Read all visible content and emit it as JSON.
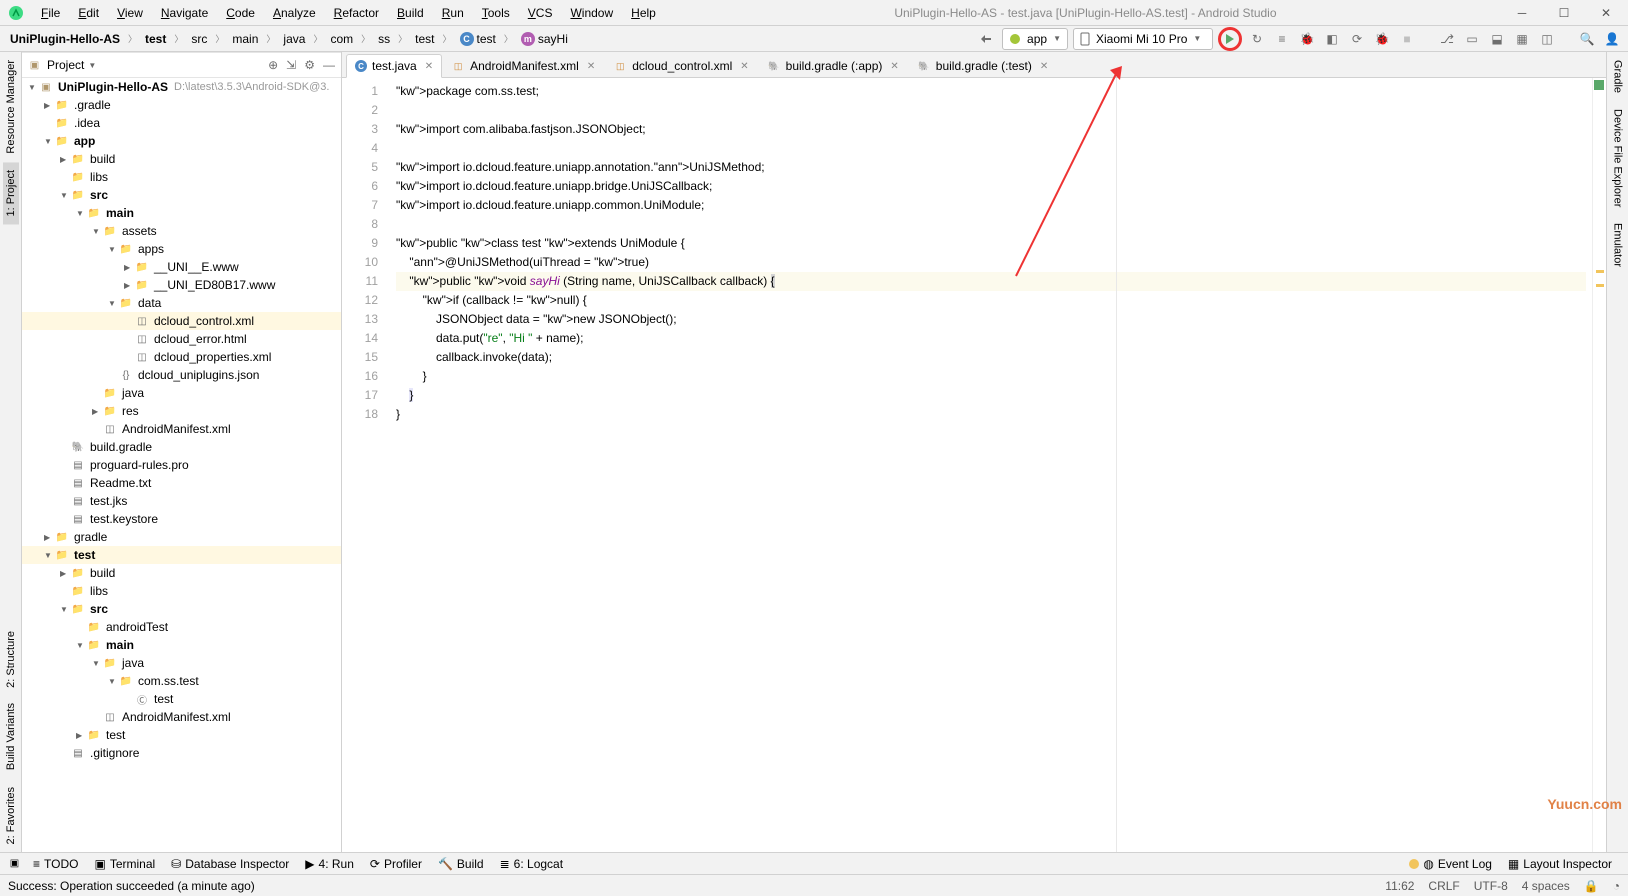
{
  "window": {
    "title": "UniPlugin-Hello-AS - test.java [UniPlugin-Hello-AS.test] - Android Studio"
  },
  "menu": [
    "File",
    "Edit",
    "View",
    "Navigate",
    "Code",
    "Analyze",
    "Refactor",
    "Build",
    "Run",
    "Tools",
    "VCS",
    "Window",
    "Help"
  ],
  "breadcrumbs": [
    {
      "label": "UniPlugin-Hello-AS",
      "bold": true
    },
    {
      "label": "test",
      "bold": true
    },
    {
      "label": "src"
    },
    {
      "label": "main"
    },
    {
      "label": "java"
    },
    {
      "label": "com"
    },
    {
      "label": "ss"
    },
    {
      "label": "test"
    },
    {
      "label": "test",
      "icon": "class"
    },
    {
      "label": "sayHi",
      "icon": "method"
    }
  ],
  "run_config": {
    "module": "app",
    "device": "Xiaomi Mi 10 Pro"
  },
  "project_pane": {
    "title": "Project",
    "root": {
      "label": "UniPlugin-Hello-AS",
      "path": "D:\\latest\\3.5.3\\Android-SDK@3."
    }
  },
  "tree": [
    {
      "depth": 0,
      "arrow": "▼",
      "icon": "proj",
      "label": "UniPlugin-Hello-AS",
      "extra": "D:\\latest\\3.5.3\\Android-SDK@3.",
      "bold": true
    },
    {
      "depth": 1,
      "arrow": "▶",
      "icon": "folder",
      "label": ".gradle"
    },
    {
      "depth": 1,
      "arrow": "",
      "icon": "folder",
      "label": ".idea"
    },
    {
      "depth": 1,
      "arrow": "▼",
      "icon": "folder",
      "label": "app",
      "bold": true
    },
    {
      "depth": 2,
      "arrow": "▶",
      "icon": "build",
      "label": "build"
    },
    {
      "depth": 2,
      "arrow": "",
      "icon": "folder",
      "label": "libs"
    },
    {
      "depth": 2,
      "arrow": "▼",
      "icon": "src",
      "label": "src",
      "bold": true
    },
    {
      "depth": 3,
      "arrow": "▼",
      "icon": "folder",
      "label": "main",
      "bold": true
    },
    {
      "depth": 4,
      "arrow": "▼",
      "icon": "folder",
      "label": "assets"
    },
    {
      "depth": 5,
      "arrow": "▼",
      "icon": "folder",
      "label": "apps"
    },
    {
      "depth": 6,
      "arrow": "▶",
      "icon": "folder",
      "label": "__UNI__E.www"
    },
    {
      "depth": 6,
      "arrow": "▶",
      "icon": "folder",
      "label": "__UNI_ED80B17.www"
    },
    {
      "depth": 5,
      "arrow": "▼",
      "icon": "folder",
      "label": "data"
    },
    {
      "depth": 6,
      "arrow": "",
      "icon": "xml",
      "label": "dcloud_control.xml",
      "sel": true
    },
    {
      "depth": 6,
      "arrow": "",
      "icon": "html",
      "label": "dcloud_error.html"
    },
    {
      "depth": 6,
      "arrow": "",
      "icon": "xml",
      "label": "dcloud_properties.xml"
    },
    {
      "depth": 5,
      "arrow": "",
      "icon": "json",
      "label": "dcloud_uniplugins.json"
    },
    {
      "depth": 4,
      "arrow": "",
      "icon": "src",
      "label": "java"
    },
    {
      "depth": 4,
      "arrow": "▶",
      "icon": "res",
      "label": "res"
    },
    {
      "depth": 4,
      "arrow": "",
      "icon": "xml",
      "label": "AndroidManifest.xml"
    },
    {
      "depth": 2,
      "arrow": "",
      "icon": "gradle",
      "label": "build.gradle"
    },
    {
      "depth": 2,
      "arrow": "",
      "icon": "file",
      "label": "proguard-rules.pro"
    },
    {
      "depth": 2,
      "arrow": "",
      "icon": "file",
      "label": "Readme.txt"
    },
    {
      "depth": 2,
      "arrow": "",
      "icon": "file",
      "label": "test.jks"
    },
    {
      "depth": 2,
      "arrow": "",
      "icon": "file",
      "label": "test.keystore"
    },
    {
      "depth": 1,
      "arrow": "▶",
      "icon": "folder",
      "label": "gradle"
    },
    {
      "depth": 1,
      "arrow": "▼",
      "icon": "folder",
      "label": "test",
      "bold": true,
      "sel2": true
    },
    {
      "depth": 2,
      "arrow": "▶",
      "icon": "build",
      "label": "build"
    },
    {
      "depth": 2,
      "arrow": "",
      "icon": "folder",
      "label": "libs"
    },
    {
      "depth": 2,
      "arrow": "▼",
      "icon": "src",
      "label": "src",
      "bold": true
    },
    {
      "depth": 3,
      "arrow": "",
      "icon": "folder",
      "label": "androidTest"
    },
    {
      "depth": 3,
      "arrow": "▼",
      "icon": "folder",
      "label": "main",
      "bold": true
    },
    {
      "depth": 4,
      "arrow": "▼",
      "icon": "src",
      "label": "java"
    },
    {
      "depth": 5,
      "arrow": "▼",
      "icon": "folder",
      "label": "com.ss.test"
    },
    {
      "depth": 6,
      "arrow": "",
      "icon": "class",
      "label": "test"
    },
    {
      "depth": 4,
      "arrow": "",
      "icon": "xml",
      "label": "AndroidManifest.xml"
    },
    {
      "depth": 3,
      "arrow": "▶",
      "icon": "folder",
      "label": "test"
    },
    {
      "depth": 2,
      "arrow": "",
      "icon": "file",
      "label": ".gitignore"
    }
  ],
  "tabs": [
    {
      "label": "test.java",
      "icon": "class",
      "active": true
    },
    {
      "label": "AndroidManifest.xml",
      "icon": "xml"
    },
    {
      "label": "dcloud_control.xml",
      "icon": "xml"
    },
    {
      "label": "build.gradle (:app)",
      "icon": "gradle"
    },
    {
      "label": "build.gradle (:test)",
      "icon": "gradle"
    }
  ],
  "code": {
    "lines": 18,
    "text": [
      "package com.ss.test;",
      "",
      "import com.alibaba.fastjson.JSONObject;",
      "",
      "import io.dcloud.feature.uniapp.annotation.UniJSMethod;",
      "import io.dcloud.feature.uniapp.bridge.UniJSCallback;",
      "import io.dcloud.feature.uniapp.common.UniModule;",
      "",
      "public class test extends UniModule {",
      "    @UniJSMethod(uiThread = true)",
      "    public void sayHi (String name, UniJSCallback callback) {",
      "        if (callback != null) {",
      "            JSONObject data = new JSONObject();",
      "            data.put(\"re\", \"Hi \" + name);",
      "            callback.invoke(data);",
      "        }",
      "    }",
      "}"
    ]
  },
  "left_tool_windows": [
    {
      "label": "Resource Manager"
    },
    {
      "label": "1: Project",
      "selected": true
    }
  ],
  "left_tool_windows_bottom": [
    {
      "label": "2: Structure"
    },
    {
      "label": "Build Variants"
    },
    {
      "label": "2: Favorites"
    }
  ],
  "right_tool_windows": [
    {
      "label": "Gradle"
    },
    {
      "label": "Device File Explorer"
    },
    {
      "label": "Emulator"
    }
  ],
  "bottom_tools_left": [
    {
      "icon": "≡",
      "label": "TODO"
    },
    {
      "icon": "▣",
      "label": "Terminal"
    },
    {
      "icon": "⛁",
      "label": "Database Inspector"
    },
    {
      "icon": "▶",
      "label": "4: Run"
    },
    {
      "icon": "⟳",
      "label": "Profiler"
    },
    {
      "icon": "🔨",
      "label": "Build"
    },
    {
      "icon": "≣",
      "label": "6: Logcat"
    }
  ],
  "bottom_tools_right": [
    {
      "icon": "◍",
      "label": "Event Log",
      "badge": true
    },
    {
      "icon": "▦",
      "label": "Layout Inspector"
    }
  ],
  "status": {
    "message": "Success: Operation succeeded (a minute ago)",
    "pos": "11:62",
    "eol": "CRLF",
    "enc": "UTF-8",
    "indent": "4 spaces"
  },
  "watermark": "Yuucn.com"
}
